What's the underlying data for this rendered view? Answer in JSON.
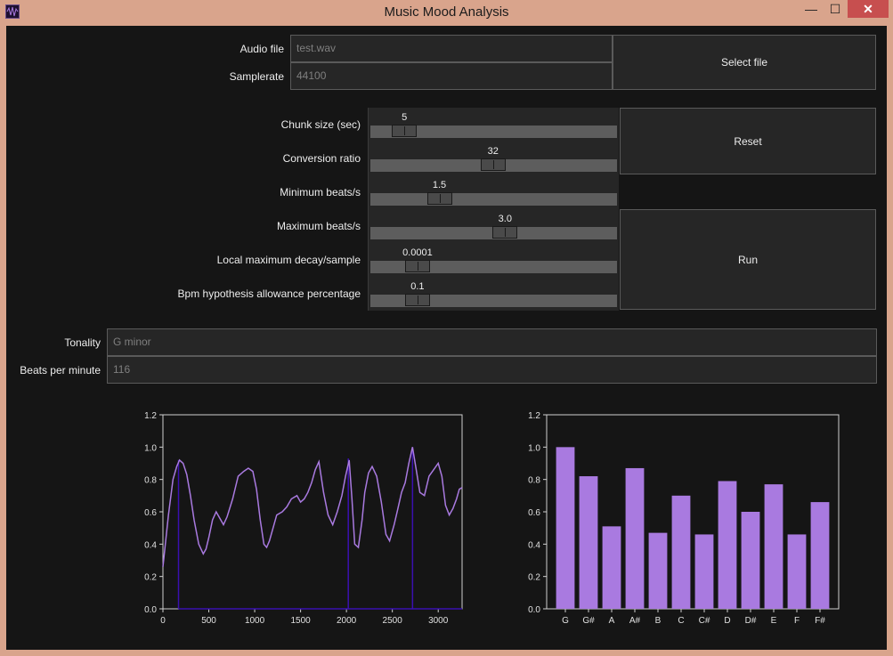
{
  "window": {
    "title": "Music Mood Analysis",
    "minimize": "—",
    "maximize": "☐",
    "close": "✕"
  },
  "audio": {
    "file_label": "Audio file",
    "file_value": "test.wav",
    "samplerate_label": "Samplerate",
    "samplerate_value": "44100",
    "select_button": "Select file"
  },
  "sliders": [
    {
      "label": "Chunk size (sec)",
      "value": "5",
      "position": 0.09
    },
    {
      "label": "Conversion ratio",
      "value": "32",
      "position": 0.495
    },
    {
      "label": "Minimum beats/s",
      "value": "1.5",
      "position": 0.25
    },
    {
      "label": "Maximum beats/s",
      "value": "3.0",
      "position": 0.55
    },
    {
      "label": "Local maximum decay/sample",
      "value": "0.0001",
      "position": 0.15
    },
    {
      "label": "Bpm hypothesis allowance percentage",
      "value": "0.1",
      "position": 0.15
    }
  ],
  "buttons": {
    "reset": "Reset",
    "run": "Run"
  },
  "results": {
    "tonality_label": "Tonality",
    "tonality_value": "G minor",
    "bpm_label": "Beats per minute",
    "bpm_value": "116"
  },
  "colors": {
    "accent": "#a97ae0",
    "peak_line": "#3a10b0",
    "background": "#151515"
  },
  "chart_data": [
    {
      "type": "line",
      "title": "",
      "xlabel": "",
      "ylabel": "",
      "xlim": [
        0,
        3260
      ],
      "ylim": [
        0,
        1.2
      ],
      "xticks": [
        0,
        500,
        1000,
        1500,
        2000,
        2500,
        3000
      ],
      "yticks": [
        0.0,
        0.2,
        0.4,
        0.6,
        0.8,
        1.0,
        1.2
      ],
      "series": [
        {
          "x": [
            0,
            60,
            110,
            150,
            180,
            220,
            260,
            300,
            340,
            390,
            440,
            470,
            500,
            540,
            580,
            620,
            660,
            700,
            760,
            820,
            880,
            930,
            980,
            1020,
            1060,
            1100,
            1130,
            1160,
            1200,
            1240,
            1300,
            1350,
            1400,
            1460,
            1500,
            1540,
            1580,
            1620,
            1660,
            1700,
            1750,
            1800,
            1850,
            1900,
            1950,
            1990,
            2030,
            2060,
            2090,
            2130,
            2170,
            2200,
            2240,
            2280,
            2330,
            2380,
            2430,
            2470,
            2520,
            2560,
            2600,
            2640,
            2680,
            2720,
            2760,
            2800,
            2850,
            2900,
            2950,
            3000,
            3040,
            3080,
            3120,
            3160,
            3200,
            3230,
            3260
          ],
          "y": [
            0.26,
            0.58,
            0.8,
            0.88,
            0.92,
            0.9,
            0.83,
            0.7,
            0.55,
            0.4,
            0.34,
            0.37,
            0.44,
            0.55,
            0.6,
            0.56,
            0.52,
            0.57,
            0.68,
            0.82,
            0.85,
            0.87,
            0.85,
            0.74,
            0.55,
            0.4,
            0.38,
            0.42,
            0.5,
            0.58,
            0.6,
            0.63,
            0.68,
            0.7,
            0.66,
            0.68,
            0.72,
            0.78,
            0.86,
            0.91,
            0.72,
            0.58,
            0.52,
            0.6,
            0.7,
            0.82,
            0.92,
            0.68,
            0.4,
            0.38,
            0.55,
            0.72,
            0.84,
            0.88,
            0.82,
            0.66,
            0.46,
            0.42,
            0.52,
            0.62,
            0.72,
            0.78,
            0.9,
            1.0,
            0.86,
            0.72,
            0.7,
            0.82,
            0.86,
            0.9,
            0.82,
            0.64,
            0.58,
            0.62,
            0.68,
            0.74,
            0.75
          ]
        },
        {
          "name": "peaks",
          "x": [
            170,
            2020,
            2720
          ],
          "y": [
            0.92,
            0.93,
            1.0
          ]
        }
      ]
    },
    {
      "type": "bar",
      "title": "",
      "xlabel": "",
      "ylabel": "",
      "categories": [
        "G",
        "G#",
        "A",
        "A#",
        "B",
        "C",
        "C#",
        "D",
        "D#",
        "E",
        "F",
        "F#"
      ],
      "values": [
        1.0,
        0.82,
        0.51,
        0.87,
        0.47,
        0.7,
        0.46,
        0.79,
        0.6,
        0.77,
        0.46,
        0.66
      ],
      "ylim": [
        0,
        1.2
      ],
      "yticks": [
        0.0,
        0.2,
        0.4,
        0.6,
        0.8,
        1.0,
        1.2
      ]
    }
  ]
}
